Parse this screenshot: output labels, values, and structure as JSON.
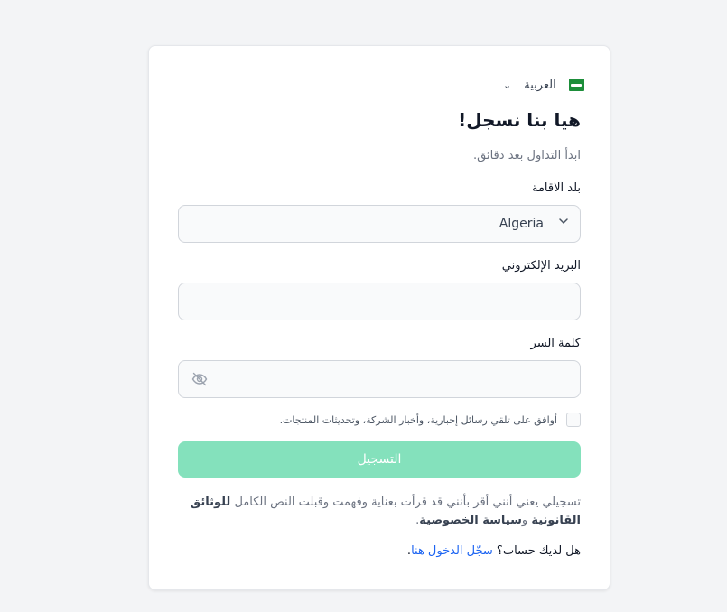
{
  "language": {
    "label": "العربية",
    "flag_icon": "saudi-flag-icon",
    "chevron_icon": "chevron-down-icon"
  },
  "header": {
    "title": "هيا بنا نسجل!",
    "subtitle": "ابدأ التداول بعد دقائق."
  },
  "country": {
    "label": "بلد الاقامة",
    "value": "Algeria"
  },
  "email": {
    "label": "البريد الإلكتروني",
    "value": ""
  },
  "password": {
    "label": "كلمة السر",
    "value": "",
    "toggle_icon": "eye-off-icon"
  },
  "newsletter": {
    "label": "أوافق على تلقي رسائل إخبارية، وأخبار الشركة، وتحديثات المنتجات.",
    "checked": false
  },
  "submit": {
    "label": "التسجيل",
    "color": "#84e1bc"
  },
  "terms": {
    "prefix": "تسجيلي يعني أنني أقر بأنني قد قرأت بعناية وفهمت وقبلت النص الكامل",
    "legal_link": "للوثائق القانونية",
    "connector": " و",
    "privacy_link": "سياسة الخصوصية",
    "suffix": "."
  },
  "login": {
    "question": "هل لديك حساب؟ ",
    "link": "سجّل الدخول هنا",
    "suffix": "."
  },
  "colors": {
    "link": "#1c64f2",
    "background": "#f3f4f6"
  }
}
